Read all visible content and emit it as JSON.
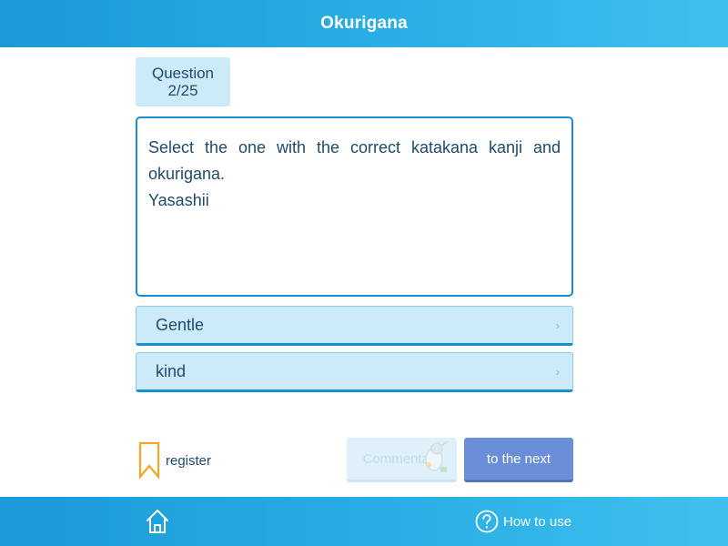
{
  "header": {
    "title": "Okurigana"
  },
  "question_badge": {
    "line1": "Question",
    "line2": "2/25"
  },
  "question": {
    "text": "Select the one with the correct katakana kanji and okurigana.",
    "word": "Yasashii"
  },
  "options": [
    {
      "label": "Gentle",
      "icon": "chevron-right-icon"
    },
    {
      "label": "kind",
      "icon": "chevron-right-icon"
    }
  ],
  "register": {
    "label": "register",
    "icon": "bookmark-icon"
  },
  "comment_button": {
    "label": "Commentary",
    "state": "disabled"
  },
  "next_button": {
    "label": "to the next"
  },
  "footer": {
    "home_icon": "home-icon",
    "howto_label": "How to use",
    "howto_icon": "question-circle-icon"
  },
  "colors": {
    "header_bar": "#1a9ad8",
    "option_bg": "#cdeaf8",
    "border_blue": "#1a8fd0",
    "next_button": "#6a8fd8",
    "bookmark": "#f5a623",
    "text": "#1e4a6e"
  }
}
